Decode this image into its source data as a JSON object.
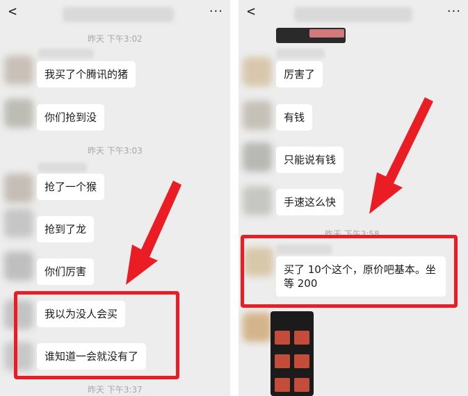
{
  "left_panel": {
    "back_icon": "chevron-left-icon",
    "more_label": "···",
    "timestamps": [
      "昨天 下午3:02",
      "昨天 下午3:03",
      "昨天 下午3:37"
    ],
    "messages": [
      "我买了个腾讯的猪",
      "你们抢到没",
      "抢了一个猴",
      "抢到了龙",
      "你们厉害",
      "我以为没人会买",
      "谁知道一会就没有了"
    ]
  },
  "right_panel": {
    "back_icon": "chevron-left-icon",
    "more_label": "···",
    "timestamps": [
      "昨天 下午3:58"
    ],
    "messages": [
      "厉害了",
      "有钱",
      "只能说有钱",
      "手速这么快",
      "买了 10个这个，原价吧基本。坐等 200"
    ]
  },
  "colors": {
    "highlight": "#ea1c24",
    "background": "#ededed",
    "bubble": "#ffffff"
  }
}
